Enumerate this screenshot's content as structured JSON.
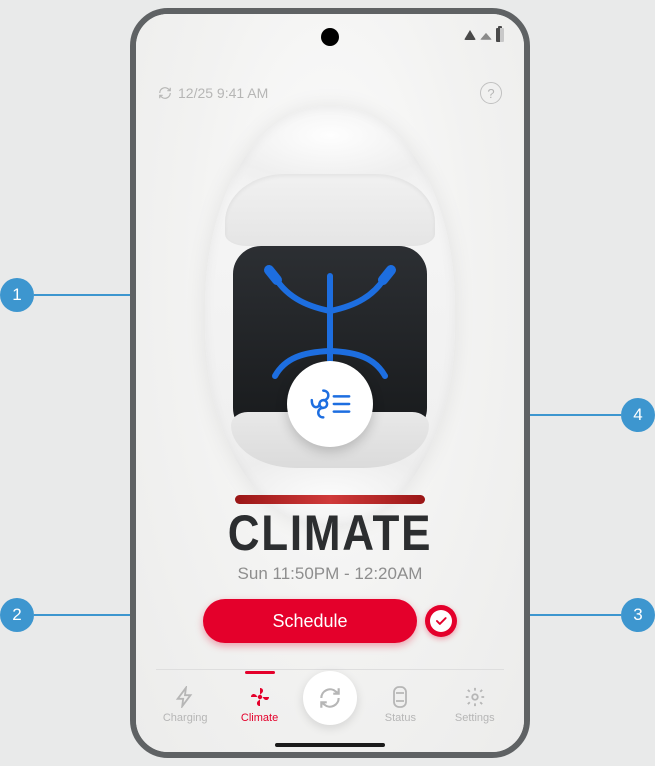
{
  "header": {
    "last_sync": "12/25 9:41 AM"
  },
  "title": "CLIMATE",
  "subtitle": "Sun 11:50PM - 12:20AM",
  "schedule_button": "Schedule",
  "nav": {
    "charging": "Charging",
    "climate": "Climate",
    "status": "Status",
    "settings": "Settings"
  },
  "callouts": {
    "1": "1",
    "2": "2",
    "3": "3",
    "4": "4"
  },
  "colors": {
    "accent": "#e4002b",
    "callout": "#3d96cf",
    "airflow": "#1d6ee0"
  }
}
